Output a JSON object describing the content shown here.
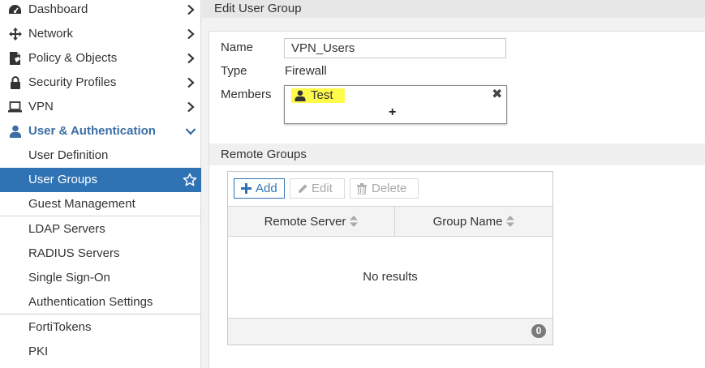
{
  "sidebar": {
    "items": [
      {
        "label": "Dashboard",
        "icon": "dashboard-icon"
      },
      {
        "label": "Network",
        "icon": "network-move-icon"
      },
      {
        "label": "Policy & Objects",
        "icon": "policy-document-icon"
      },
      {
        "label": "Security Profiles",
        "icon": "lock-icon"
      },
      {
        "label": "VPN",
        "icon": "laptop-icon"
      },
      {
        "label": "User & Authentication",
        "icon": "user-icon",
        "expanded": true
      }
    ],
    "sub_items": [
      {
        "label": "User Definition"
      },
      {
        "label": "User Groups",
        "active": true
      },
      {
        "label": "Guest Management"
      },
      {
        "label": "LDAP Servers"
      },
      {
        "label": "RADIUS Servers"
      },
      {
        "label": "Single Sign-On"
      },
      {
        "label": "Authentication Settings"
      },
      {
        "label": "FortiTokens"
      },
      {
        "label": "PKI"
      }
    ]
  },
  "header": {
    "title": "Edit User Group"
  },
  "form": {
    "name_label": "Name",
    "name_value": "VPN_Users",
    "type_label": "Type",
    "type_value": "Firewall",
    "members_label": "Members",
    "members": [
      {
        "name": "Test",
        "highlighted": true
      }
    ],
    "add_member_glyph": "+",
    "remove_glyph": "✖"
  },
  "remote_groups": {
    "section_title": "Remote Groups",
    "buttons": {
      "add": "Add",
      "edit": "Edit",
      "delete": "Delete"
    },
    "columns": [
      "Remote Server",
      "Group Name"
    ],
    "empty_text": "No results",
    "count": "0"
  },
  "colors": {
    "accent": "#2f73b4",
    "active_bg": "#2f73b4",
    "expanded_text": "#3a6ea5",
    "highlight": "#fffb4a"
  }
}
